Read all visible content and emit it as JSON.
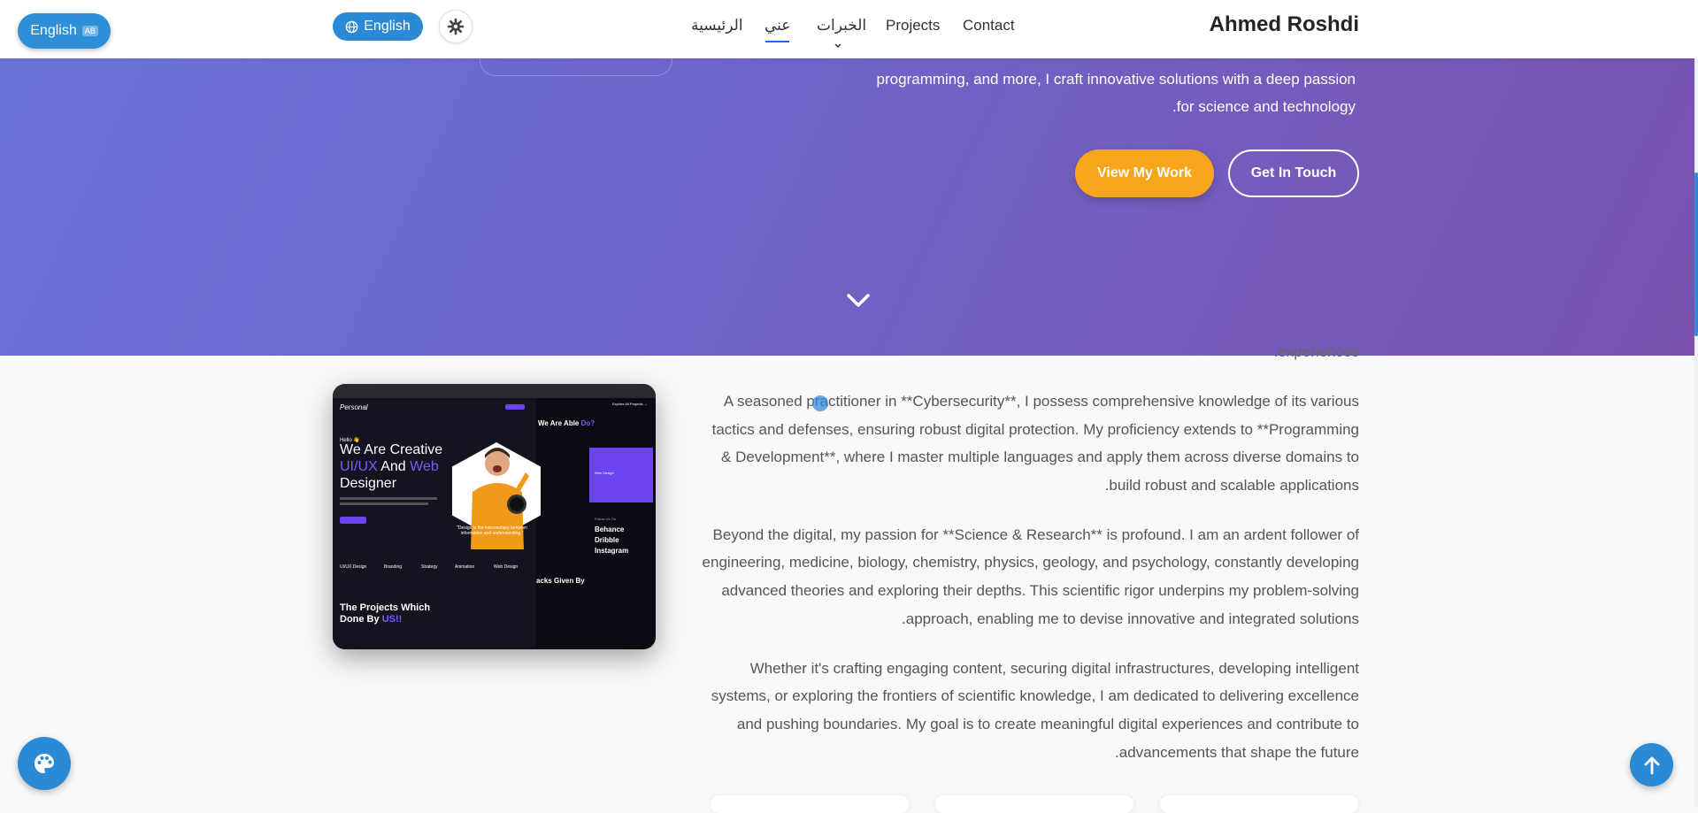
{
  "header": {
    "brand": "Ahmed Roshdi",
    "nav": [
      "Contact",
      "Projects",
      "الخبرات",
      "عني",
      "الرئيسية"
    ],
    "lang_label": "English",
    "floating_lang_label": "English",
    "floating_lang_badge": "AB"
  },
  "hero": {
    "lines": [
      "programming, and more, I craft innovative solutions with a deep passion",
      ".for science and technology"
    ],
    "buttons": {
      "view_work": "View My Work",
      "get_in_touch": "Get In Touch"
    }
  },
  "about": {
    "cut_line": ".experiences",
    "paragraphs": [
      [
        "A seasoned practitioner in **Cybersecurity**, I possess comprehensive knowledge of its various",
        "tactics and defenses, ensuring robust digital protection. My proficiency extends to **Programming",
        "& Development**, where I master multiple languages and apply them across diverse domains to",
        ".build robust and scalable applications"
      ],
      [
        "Beyond the digital, my passion for **Science & Research** is profound. I am an ardent follower of",
        "engineering, medicine, biology, chemistry, physics, geology, and psychology, constantly developing",
        "advanced theories and exploring their depths. This scientific rigor underpins my problem-solving",
        ".approach, enabling me to devise innovative and integrated solutions"
      ],
      [
        "Whether it's crafting engaging content, securing digital infrastructures, developing intelligent",
        "systems, or exploring the frontiers of scientific knowledge, I am dedicated to delivering excellence",
        "and pushing boundaries. My goal is to create meaningful digital experiences and contribute to",
        ".advancements that shape the future"
      ]
    ]
  },
  "mockup": {
    "logo": "Personal",
    "hello": "Hello 👋",
    "headline_1": "We Are Creative",
    "headline_2a": "UI/UX",
    "headline_2b": " And ",
    "headline_2c": "Web",
    "headline_3": "Designer",
    "quote": "\"Design is the intermediary between information and understanding.\"",
    "services": [
      "UI/UX Design",
      "Branding",
      "Strategy",
      "Animation",
      "Web Design"
    ],
    "projects_1": "The Projects Which",
    "projects_2": "Done By ",
    "projects_us": "US!!",
    "able_1": "We Are Able ",
    "able_2": "Do?",
    "explore": "Explore All Projects →",
    "web_design": "Web Design",
    "follow_us": "Follow Us On",
    "socials": [
      "Behance",
      "Dribble",
      "Instagram"
    ],
    "feedback": "acks Given By"
  },
  "colors": {
    "hero_start": "#6a74d9",
    "hero_end": "#7a52ae",
    "accent_orange": "#f7a51a",
    "accent_blue": "#2b8ad6",
    "nav_active": "#0d6efd"
  },
  "icons": [
    "globe-icon",
    "gear-icon",
    "chevron-down-icon",
    "palette-icon",
    "arrow-up-icon"
  ]
}
